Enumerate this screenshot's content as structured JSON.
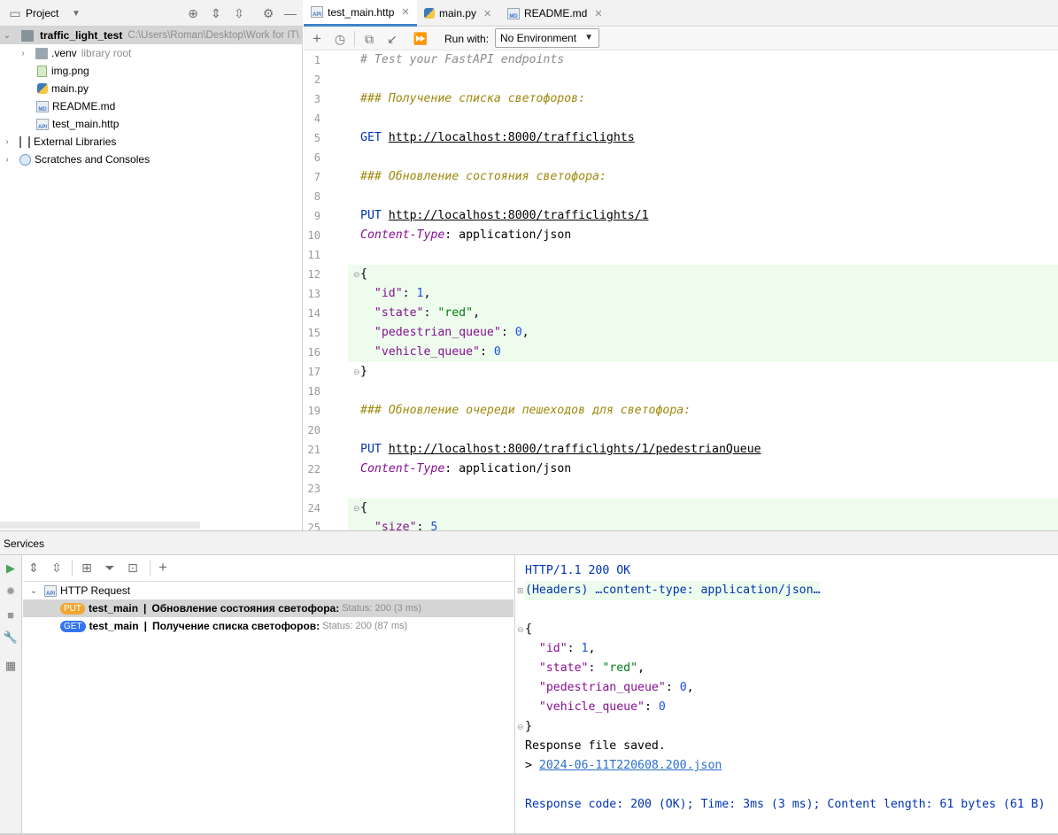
{
  "project": {
    "title": "Project",
    "tree": [
      {
        "label": "traffic_light_test",
        "path": "C:\\Users\\Roman\\Desktop\\Work for IT\\",
        "bold": true
      },
      {
        "label": ".venv",
        "note": "library root"
      },
      {
        "label": "img.png"
      },
      {
        "label": "main.py"
      },
      {
        "label": "README.md"
      },
      {
        "label": "test_main.http"
      },
      {
        "label": "External Libraries"
      },
      {
        "label": "Scratches and Consoles"
      }
    ]
  },
  "tabs": [
    {
      "label": "test_main.http",
      "active": true
    },
    {
      "label": "main.py"
    },
    {
      "label": "README.md"
    }
  ],
  "toolbar": {
    "run_with_label": "Run with:",
    "environment": "No Environment"
  },
  "editor": {
    "line_numbers": [
      "1",
      "2",
      "3",
      "4",
      "5",
      "6",
      "7",
      "8",
      "9",
      "10",
      "11",
      "12",
      "13",
      "14",
      "15",
      "16",
      "17",
      "18",
      "19",
      "20",
      "21",
      "22",
      "23",
      "24",
      "25"
    ],
    "lines": {
      "l1": "# Test your FastAPI endpoints",
      "l3": "### Получение списка светофоров:",
      "l5_method": "GET",
      "l5_url": "http://localhost:8000/trafficlights",
      "l7": "### Обновление состояния светофора:",
      "l9_method": "PUT",
      "l9_url": "http://localhost:8000/trafficlights/1",
      "l10_key": "Content-Type",
      "l10_val": ": application/json",
      "l12": "{",
      "l13_key": "\"id\"",
      "l13_val": "1",
      "l14_key": "\"state\"",
      "l14_val": "\"red\"",
      "l15_key": "\"pedestrian_queue\"",
      "l15_val": "0",
      "l16_key": "\"vehicle_queue\"",
      "l16_val": "0",
      "l17": "}",
      "l19": "### Обновление очереди пешеходов для светофора:",
      "l21_method": "PUT",
      "l21_url": "http://localhost:8000/trafficlights/1/pedestrianQueue",
      "l22_key": "Content-Type",
      "l22_val": ": application/json",
      "l24": "{",
      "l25_key": "\"size\"",
      "l25_val": "5"
    }
  },
  "services": {
    "title": "Services",
    "group": "HTTP Request",
    "requests": [
      {
        "method": "PUT",
        "name": "test_main",
        "separator": "|",
        "title": "Обновление состояния светофора:",
        "status": "Status: 200 (3 ms)"
      },
      {
        "method": "GET",
        "name": "test_main",
        "separator": "|",
        "title": "Получение списка светофоров:",
        "status": "Status: 200 (87 ms)"
      }
    ]
  },
  "response": {
    "status_line": "HTTP/1.1 200 OK",
    "headers_line": "(Headers) …content-type: application/json…",
    "body_open": "{",
    "body": [
      {
        "key": "\"id\"",
        "value": "1",
        "kind": "num"
      },
      {
        "key": "\"state\"",
        "value": "\"red\"",
        "kind": "str"
      },
      {
        "key": "\"pedestrian_queue\"",
        "value": "0",
        "kind": "num"
      },
      {
        "key": "\"vehicle_queue\"",
        "value": "0",
        "kind": "num"
      }
    ],
    "body_close": "}",
    "saved_text": "Response file saved.",
    "file_prefix": "> ",
    "file_link": "2024-06-11T220608.200.json",
    "summary": "Response code: 200 (OK); Time: 3ms (3 ms); Content length: 61 bytes (61 B)"
  }
}
